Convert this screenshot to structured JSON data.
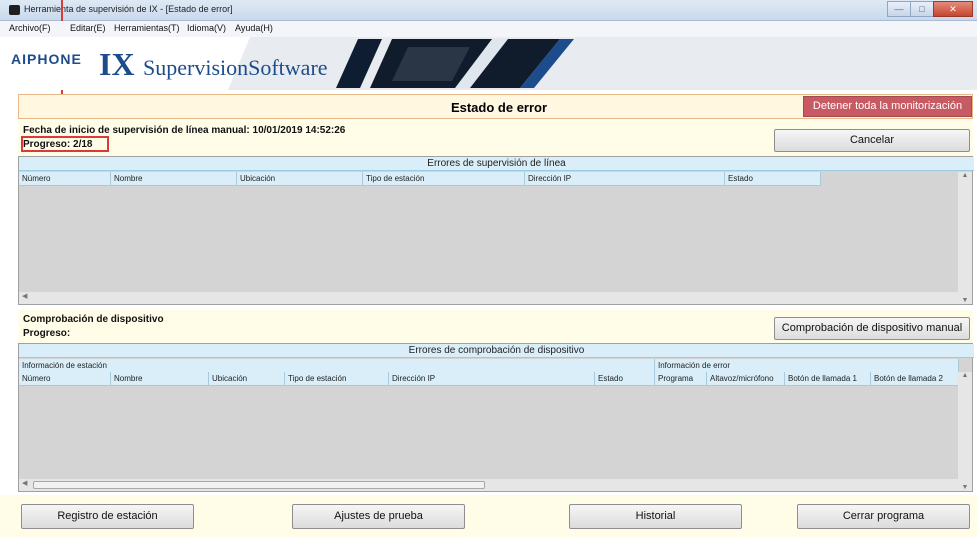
{
  "window": {
    "title": "Herramienta de supervisión de IX - [Estado de error]",
    "buttons": [
      "minimize",
      "maximize",
      "close"
    ]
  },
  "menu": [
    "Archivo(F)",
    "Editar(E)",
    "Herramientas(T)",
    "Idioma(V)",
    "Ayuda(H)"
  ],
  "banner": {
    "brand": "AIPHONE",
    "product_prefix": "IX",
    "product_name": "SupervisionSoftware"
  },
  "status": {
    "title": "Estado de error",
    "stop_all_label": "Detener toda la monitorización"
  },
  "line_supervision": {
    "start_label": "Fecha de inicio de supervisión de línea manual: 10/01/2019 14:52:26",
    "progress_label": "Progreso: 2/18",
    "cancel_label": "Cancelar",
    "grid_title": "Errores de supervisión de línea",
    "columns": [
      "Número",
      "Nombre",
      "Ubicación",
      "Tipo de estación",
      "Dirección IP",
      "Estado"
    ],
    "rows": []
  },
  "device_check": {
    "title": "Comprobación de dispositivo",
    "progress_label": "Progreso:",
    "manual_label": "Comprobación de dispositivo manual",
    "grid_title": "Errores de comprobación de dispositivo",
    "group_station": "Información de estación",
    "group_error": "Información de error",
    "columns": [
      "Número",
      "Nombre",
      "Ubicación",
      "Tipo de estación",
      "Dirección IP",
      "Estado",
      "Programa",
      "Altavoz/micrófono",
      "Botón de llamada 1",
      "Botón de llamada 2"
    ],
    "rows": []
  },
  "footer": {
    "station_register": "Registro de estación",
    "test_settings": "Ajustes de prueba",
    "history": "Historial",
    "close_program": "Cerrar programa"
  },
  "colors": {
    "stop_button": "#c85a63",
    "header_blue": "#d9eef8",
    "panel_cream": "#fffce8",
    "highlight_red": "#d93b3b",
    "brand_blue": "#1d4c8c"
  }
}
